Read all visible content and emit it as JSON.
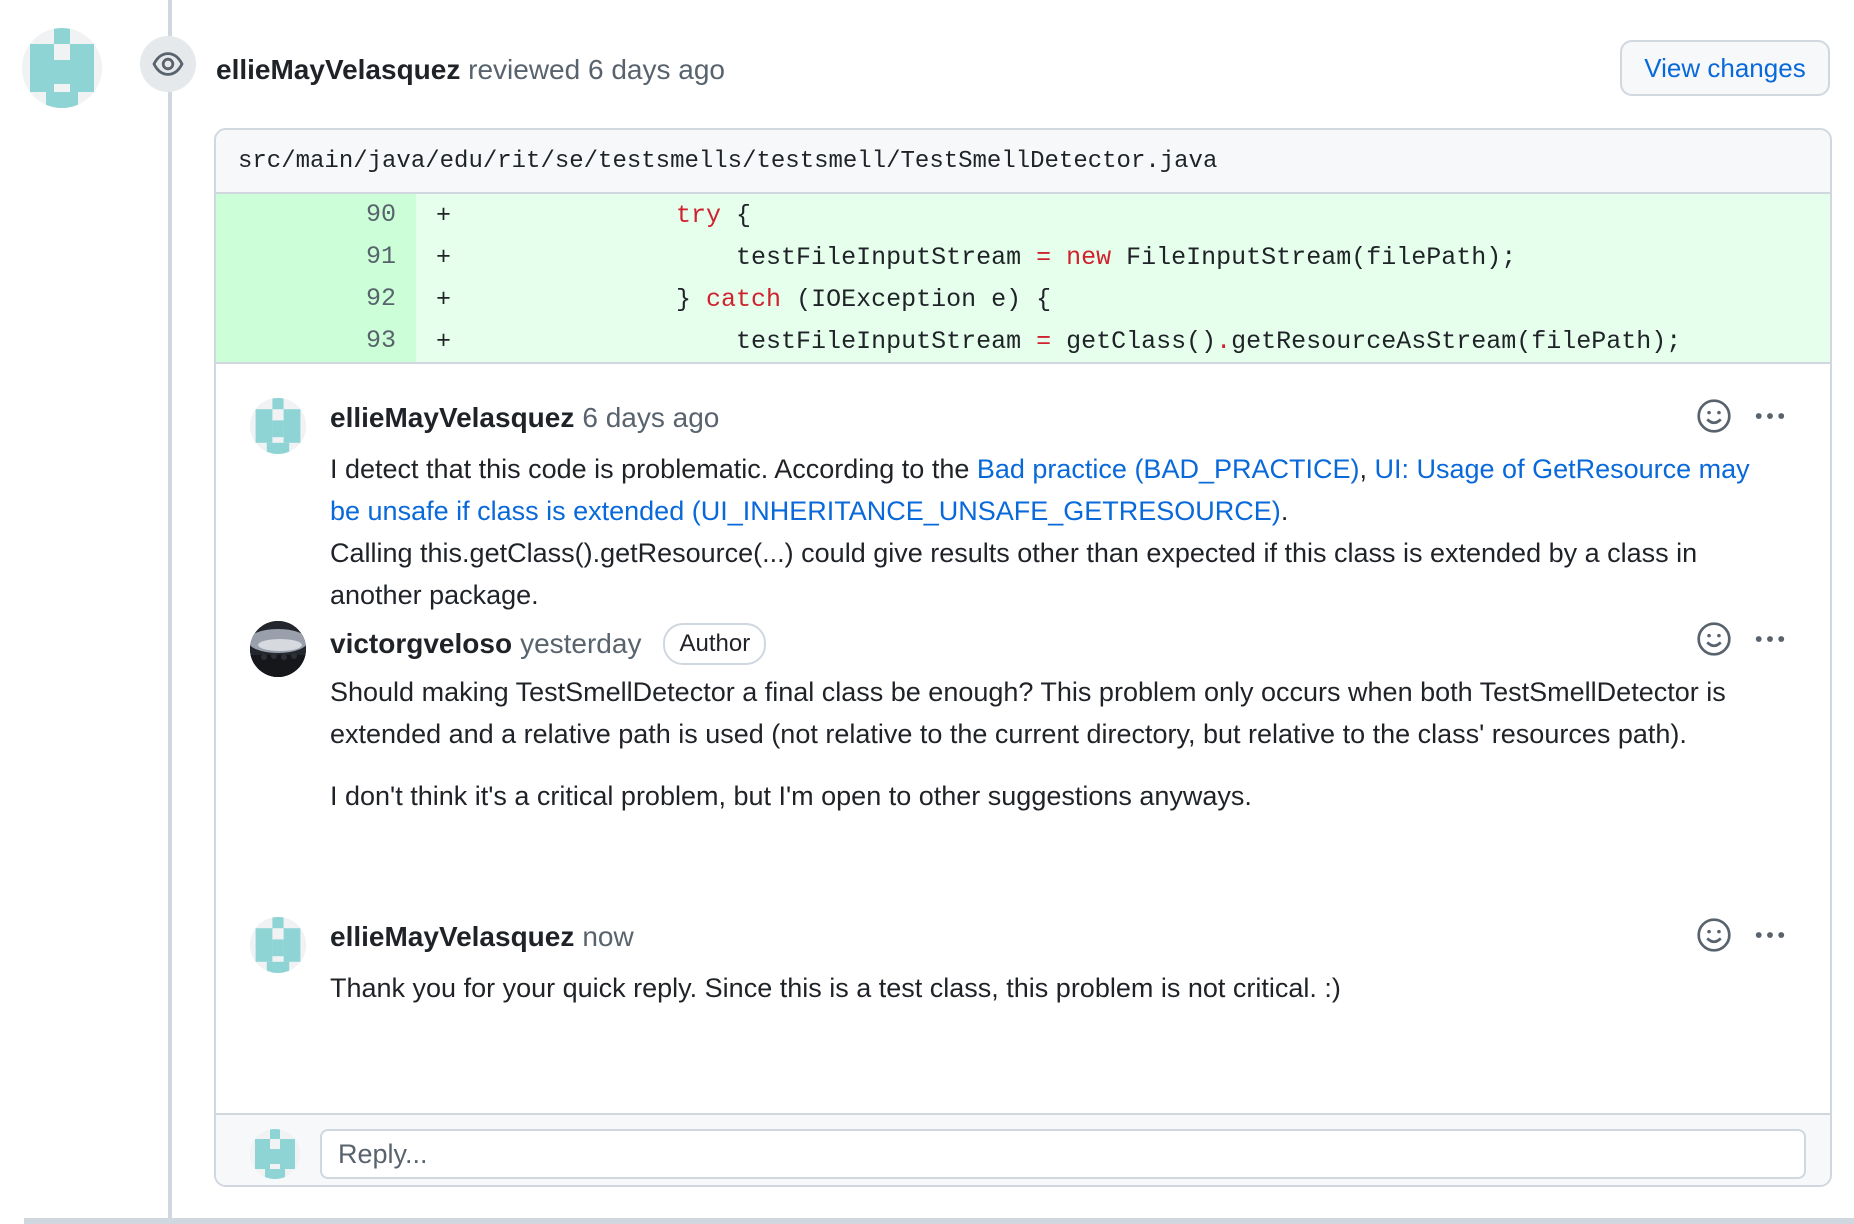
{
  "review": {
    "reviewer": "ellieMayVelasquez",
    "action": "reviewed",
    "time": "6 days ago",
    "view_changes_label": "View changes",
    "icon": "eye-icon"
  },
  "file": {
    "path": "src/main/java/edu/rit/se/testsmells/testsmell/TestSmellDetector.java"
  },
  "diff": {
    "lines": [
      {
        "num": "90",
        "mark": "+"
      },
      {
        "num": "91",
        "mark": "+"
      },
      {
        "num": "92",
        "mark": "+"
      },
      {
        "num": "93",
        "mark": "+"
      }
    ],
    "tokens": {
      "l90_kw": "try",
      "l90_rest": " {",
      "l91_a": "testFileInputStream ",
      "l91_op": "=",
      "l91_sp": " ",
      "l91_kw": "new",
      "l91_rest": " FileInputStream(filePath);",
      "l92_a": "} ",
      "l92_kw": "catch",
      "l92_rest": " (IOException e) {",
      "l93_a": "testFileInputStream ",
      "l93_op": "=",
      "l93_b": " getClass()",
      "l93_dot": ".",
      "l93_rest": "getResourceAsStream(filePath);"
    }
  },
  "comments": [
    {
      "author": "ellieMayVelasquez",
      "time": "6 days ago",
      "body_intro": "I detect that this code is problematic. According to the ",
      "link1": "Bad practice (BAD_PRACTICE)",
      "sep": ", ",
      "link2": "UI: Usage of GetResource may be unsafe if class is extended (UI_INHERITANCE_UNSAFE_GETRESOURCE)",
      "period": ".",
      "body_rest": "Calling this.getClass().getResource(...) could give results other than expected if this class is extended by a class in another package."
    },
    {
      "author": "victorgveloso",
      "time": "yesterday",
      "badge": "Author",
      "para1": "Should making TestSmellDetector a final class be enough? This problem only occurs when both TestSmellDetector is extended and a relative path is used (not relative to the current directory, but relative to the class' resources path).",
      "para2": "I don't think it's a critical problem, but I'm open to other suggestions anyways."
    },
    {
      "author": "ellieMayVelasquez",
      "time": "now",
      "body": "Thank you for your quick reply. Since this is a test class, this problem is not critical. :)"
    }
  ],
  "reply": {
    "placeholder": "Reply..."
  },
  "icons": {
    "comment_actions": [
      "smiley-icon",
      "kebab-menu-icon"
    ]
  },
  "colors": {
    "link": "#0969da",
    "addition_bg": "#e6ffec",
    "addition_gutter": "#ccffd8",
    "keyword": "#cf222e",
    "identicon": "#8fd4d5"
  }
}
